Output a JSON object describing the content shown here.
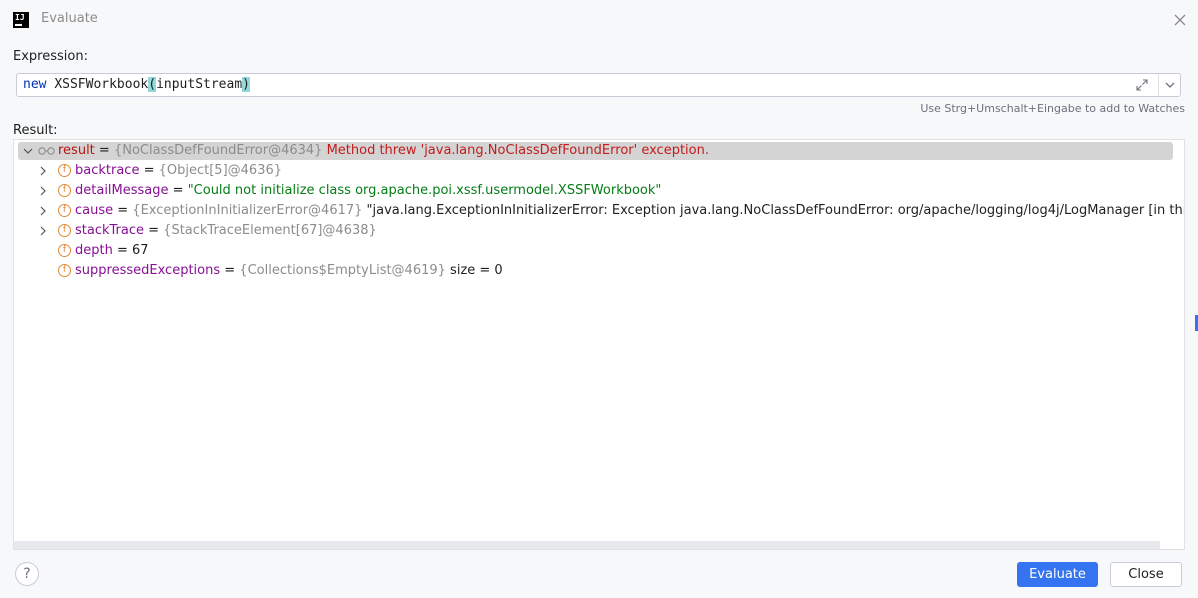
{
  "window": {
    "title": "Evaluate",
    "app_icon_text": "IJ"
  },
  "expression": {
    "label": "Expression:",
    "keyword": "new",
    "class_name": "XSSFWorkbook",
    "open_paren": "(",
    "argument": "inputStream",
    "close_paren": ")"
  },
  "hint": "Use Strg+Umschalt+Eingabe to add to Watches",
  "result": {
    "label": "Result:",
    "root": {
      "name": "result",
      "eq": " = ",
      "ref": "{NoClassDefFoundError@4634}",
      "message": " Method threw 'java.lang.NoClassDefFoundError' exception."
    },
    "fields": [
      {
        "name": "backtrace",
        "eq": " = ",
        "ref": "{Object[5]@4636}",
        "value": "",
        "expandable": true
      },
      {
        "name": "detailMessage",
        "eq": " = ",
        "ref": "",
        "value": "\"Could not initialize class org.apache.poi.xssf.usermodel.XSSFWorkbook\"",
        "expandable": true
      },
      {
        "name": "cause",
        "eq": " = ",
        "ref": "{ExceptionInInitializerError@4617}",
        "value": " \"java.lang.ExceptionInInitializerError: Exception java.lang.NoClassDefFoundError: org/apache/logging/log4j/LogManager [in thread \"main\"]\"",
        "expandable": true
      },
      {
        "name": "stackTrace",
        "eq": " = ",
        "ref": "{StackTraceElement[67]@4638}",
        "value": "",
        "expandable": true
      },
      {
        "name": "depth",
        "eq": " = ",
        "ref": "",
        "value": "67",
        "expandable": false
      },
      {
        "name": "suppressedExceptions",
        "eq": " = ",
        "ref": "{Collections$EmptyList@4619}",
        "value": "  size = 0",
        "expandable": false
      }
    ]
  },
  "buttons": {
    "help": "?",
    "evaluate": "Evaluate",
    "close": "Close"
  },
  "colors": {
    "primary": "#3574f0",
    "field_badge": "#e08b38",
    "string": "#067d17",
    "error": "#c31c1c",
    "field_name": "#871094"
  }
}
